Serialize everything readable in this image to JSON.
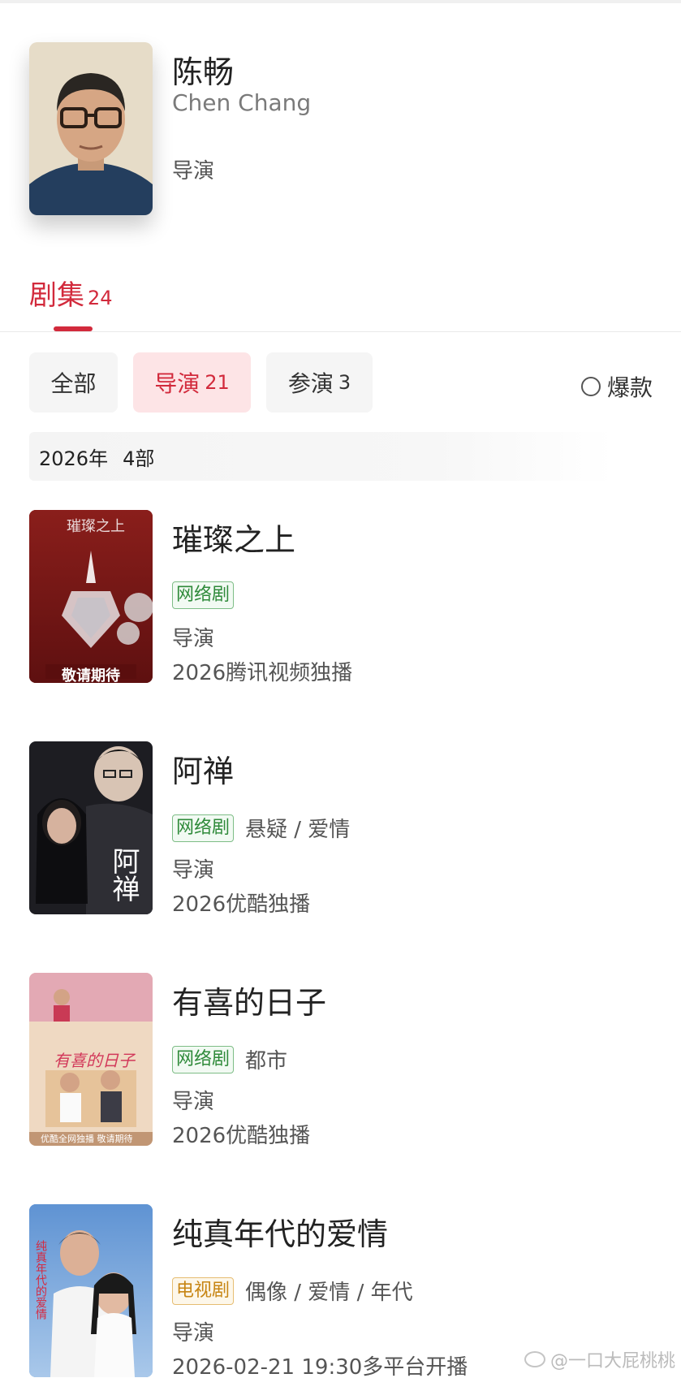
{
  "profile": {
    "name_cn": "陈畅",
    "name_en": "Chen Chang",
    "role": "导演"
  },
  "tabs": {
    "series_label": "剧集",
    "series_count": "24"
  },
  "filters": {
    "all": "全部",
    "director": "导演",
    "director_count": "21",
    "actor": "参演",
    "actor_count": "3",
    "hit": "爆款"
  },
  "year_group": {
    "year": "2026年",
    "count": "4部"
  },
  "shows": [
    {
      "title": "璀璨之上",
      "badge": "网络剧",
      "genres": "",
      "role": "导演",
      "info": "2026腾讯视频独播",
      "poster_text_top": "璀璨之上",
      "poster_text_bottom": "敬请期待"
    },
    {
      "title": "阿禅",
      "badge": "网络剧",
      "genres": "悬疑 / 爱情",
      "role": "导演",
      "info": "2026优酷独播",
      "poster_text_top": "阿禅",
      "poster_text_bottom": ""
    },
    {
      "title": "有喜的日子",
      "badge": "网络剧",
      "genres": "都市",
      "role": "导演",
      "info": "2026优酷独播",
      "poster_text_top": "有喜的日子",
      "poster_text_bottom": "优酷全网独播 敬请期待"
    },
    {
      "title": "纯真年代的爱情",
      "badge": "电视剧",
      "genres": "偶像 / 爱情 / 年代",
      "role": "导演",
      "info": "2026-02-21 19:30多平台开播",
      "poster_text_top": "纯真年代的爱情",
      "poster_text_bottom": ""
    }
  ],
  "watermark": "@一口大屁桃桃",
  "colors": {
    "accent": "#d22a3c",
    "web_badge": "#2f8a3a",
    "tv_badge": "#c78513"
  }
}
